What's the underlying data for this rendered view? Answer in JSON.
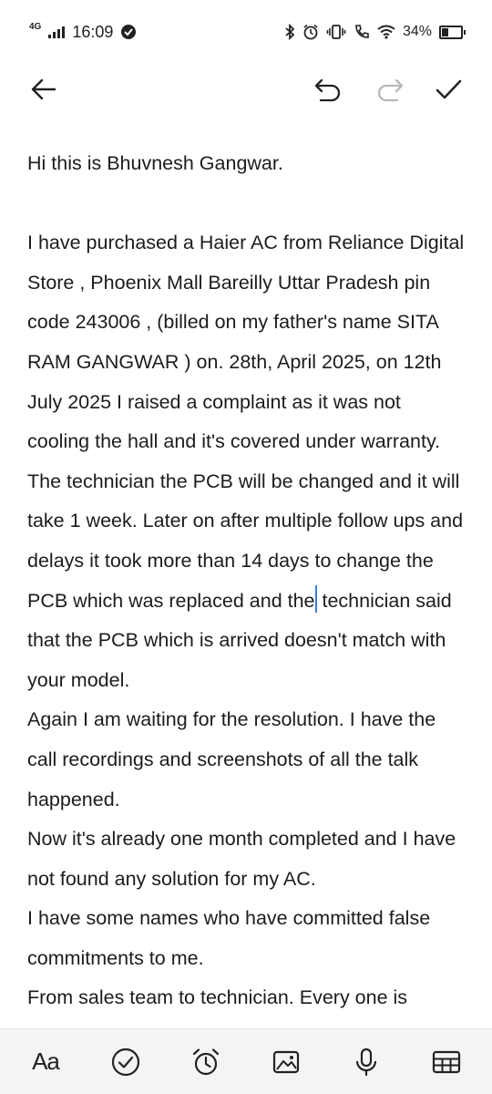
{
  "status_bar": {
    "network": "4G",
    "time": "16:09",
    "battery_percent_text": "34%",
    "battery_level": 0.34
  },
  "toolbar": {
    "back_icon": "arrow-left-icon",
    "undo_icon": "undo-icon",
    "redo_icon": "redo-icon",
    "done_icon": "check-icon"
  },
  "note": {
    "greeting": "Hi this is Bhuvnesh Gangwar.",
    "paragraph_main_before_caret": "I have purchased a Haier AC from Reliance Digital Store , Phoenix Mall Bareilly Uttar Pradesh pin code 243006 , (billed on my father's name SITA RAM GANGWAR ) on. 28th, April 2025, on 12th July 2025 I raised a complaint as it was not cooling the hall and it's covered under warranty. The technician the PCB will be changed and it will take 1 week. Later on after multiple follow ups and delays it took more than 14 days to change the PCB which was replaced and the",
    "paragraph_main_after_caret": " technician said that the PCB which is arrived doesn't match with your model.",
    "paragraph_2": "Again I am waiting for the resolution. I have the call recordings and screenshots of all the talk happened.",
    "paragraph_3": "Now it's already one month completed and I have not found any solution for my AC.",
    "paragraph_4": "I have some names who have committed false commitments to me.",
    "paragraph_5": "From sales team to technician. Every one is"
  },
  "bottom_bar": {
    "text_format_label": "Aa",
    "checklist_icon": "checkmark-circle-icon",
    "reminder_icon": "alarm-clock-icon",
    "image_icon": "image-icon",
    "voice_icon": "microphone-icon",
    "table_icon": "table-icon"
  },
  "colors": {
    "caret": "#3a7bd5",
    "text": "#1c1c1c",
    "bottom_bar_bg": "#f4f4f4",
    "redo_disabled": "#b8b8b8"
  }
}
